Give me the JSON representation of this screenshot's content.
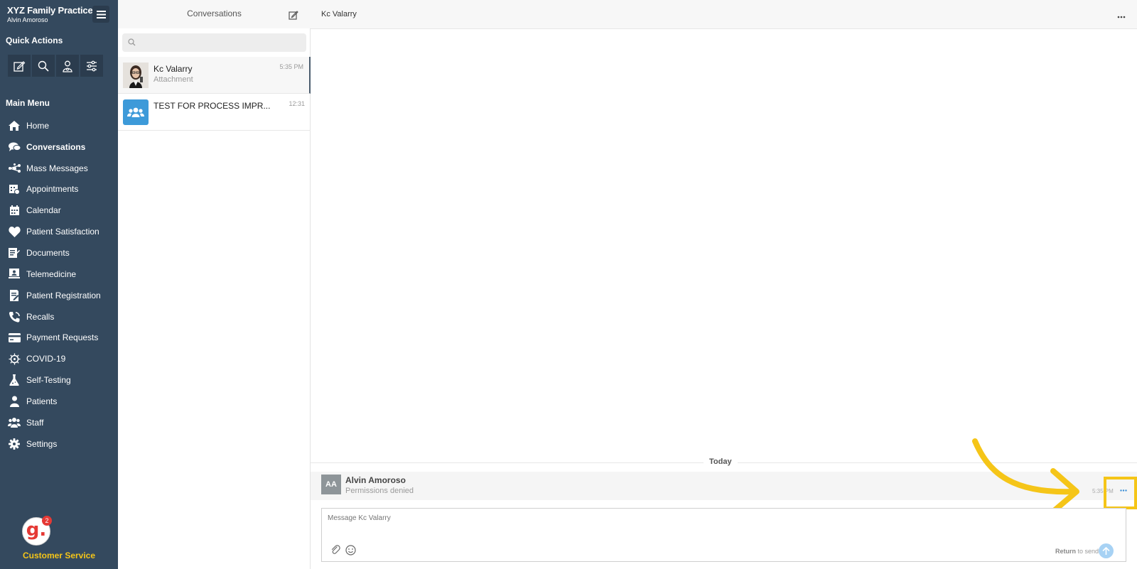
{
  "brand": {
    "title": "XYZ Family Practice",
    "user": "Alvin Amoroso"
  },
  "sidebar": {
    "quick_actions_title": "Quick Actions",
    "quick_actions": [
      {
        "icon": "compose-icon"
      },
      {
        "icon": "search-icon"
      },
      {
        "icon": "patient-icon"
      },
      {
        "icon": "sliders-icon"
      }
    ],
    "main_menu_title": "Main Menu",
    "items": [
      {
        "label": "Home",
        "icon": "home-icon"
      },
      {
        "label": "Conversations",
        "icon": "chat-icon",
        "active": true
      },
      {
        "label": "Mass Messages",
        "icon": "broadcast-icon"
      },
      {
        "label": "Appointments",
        "icon": "appointment-icon"
      },
      {
        "label": "Calendar",
        "icon": "calendar-icon"
      },
      {
        "label": "Patient Satisfaction",
        "icon": "heart-icon"
      },
      {
        "label": "Documents",
        "icon": "document-icon"
      },
      {
        "label": "Telemedicine",
        "icon": "telemedicine-icon"
      },
      {
        "label": "Patient Registration",
        "icon": "registration-icon"
      },
      {
        "label": "Recalls",
        "icon": "phone-recall-icon"
      },
      {
        "label": "Payment Requests",
        "icon": "credit-card-icon"
      },
      {
        "label": "COVID-19",
        "icon": "virus-icon"
      },
      {
        "label": "Self-Testing",
        "icon": "flask-icon"
      },
      {
        "label": "Patients",
        "icon": "person-icon"
      },
      {
        "label": "Staff",
        "icon": "staff-icon"
      },
      {
        "label": "Settings",
        "icon": "gear-icon"
      }
    ],
    "customer_service": {
      "label": "Customer Service",
      "logo": "g.",
      "badge": "2"
    }
  },
  "conversations": {
    "title": "Conversations",
    "search_placeholder": "",
    "items": [
      {
        "name": "Kc Valarry",
        "preview": "Attachment",
        "time": "5:35 PM",
        "selected": true
      },
      {
        "name": "TEST FOR PROCESS IMPR...",
        "preview": "",
        "time": "12:31",
        "selected": false
      }
    ]
  },
  "chat": {
    "title": "Kc Valarry",
    "day_label": "Today",
    "message": {
      "avatar_initials": "AA",
      "sender": "Alvin Amoroso",
      "text": "Permissions denied",
      "time": "5:35 PM"
    },
    "composer": {
      "placeholder": "Message Kc Valarry",
      "hint_key": "Return",
      "hint_text": " to send"
    }
  },
  "colors": {
    "sidebar_bg": "#34495e",
    "highlight": "#f5c518",
    "accent_blue": "#3a8ed6"
  }
}
